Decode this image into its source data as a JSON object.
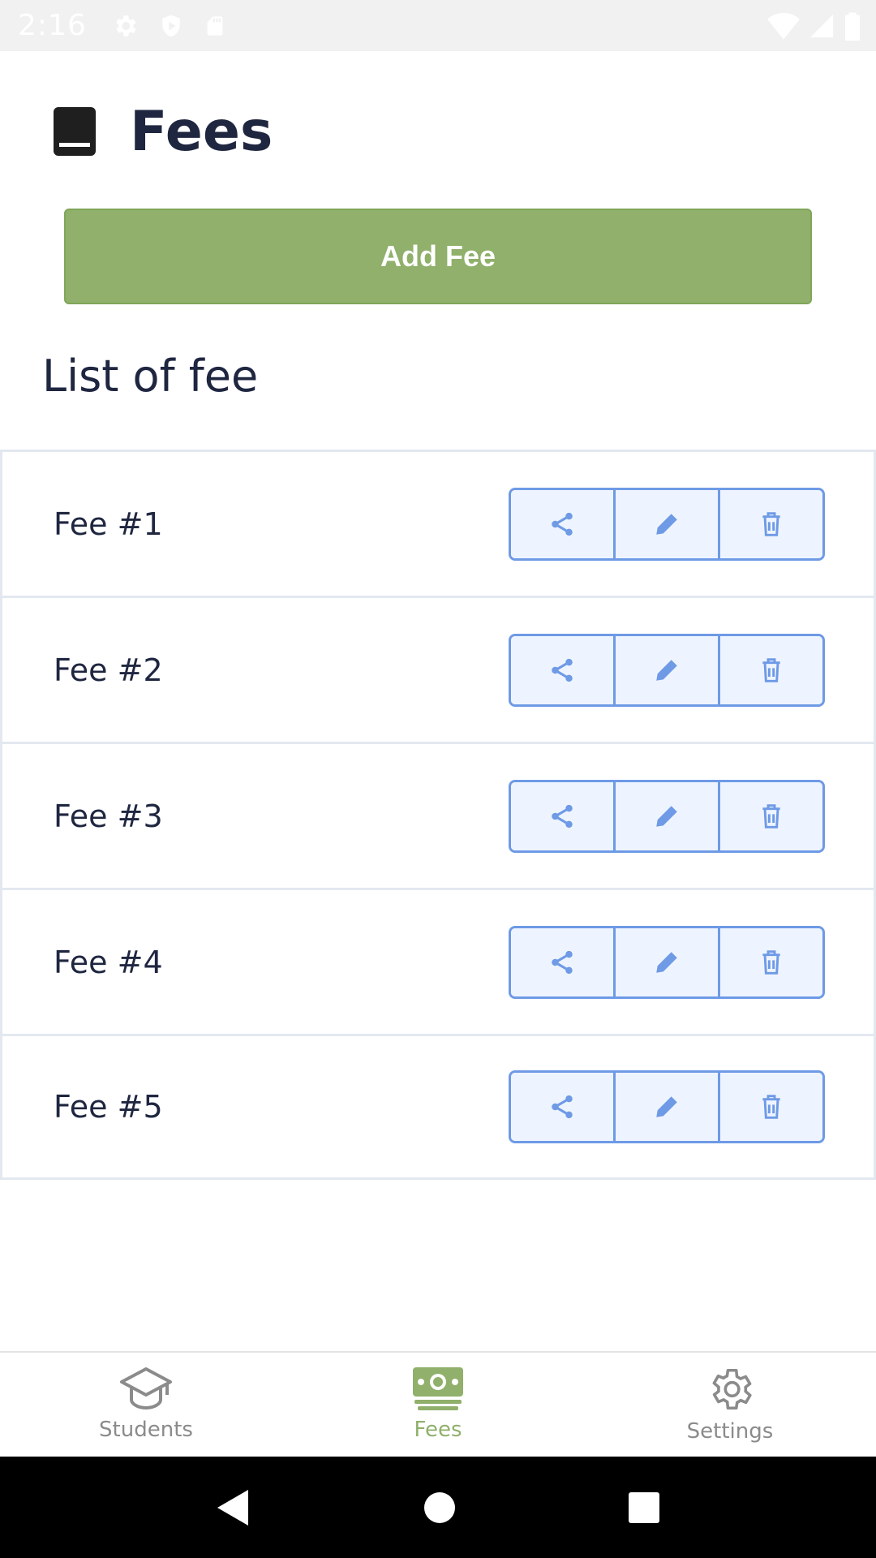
{
  "status_bar": {
    "time": "2:16"
  },
  "header": {
    "title": "Fees"
  },
  "actions": {
    "add_label": "Add Fee"
  },
  "list": {
    "title": "List of fee",
    "items": [
      {
        "name": "Fee #1"
      },
      {
        "name": "Fee #2"
      },
      {
        "name": "Fee #3"
      },
      {
        "name": "Fee #4"
      },
      {
        "name": "Fee #5"
      }
    ]
  },
  "bottom_nav": {
    "items": [
      {
        "label": "Students",
        "icon": "graduation-cap-icon"
      },
      {
        "label": "Fees",
        "icon": "money-icon",
        "active": true
      },
      {
        "label": "Settings",
        "icon": "gear-icon"
      }
    ]
  },
  "colors": {
    "accent_green": "#90b06b",
    "button_blue": "#6e9ae6",
    "title_dark": "#1f2640"
  }
}
